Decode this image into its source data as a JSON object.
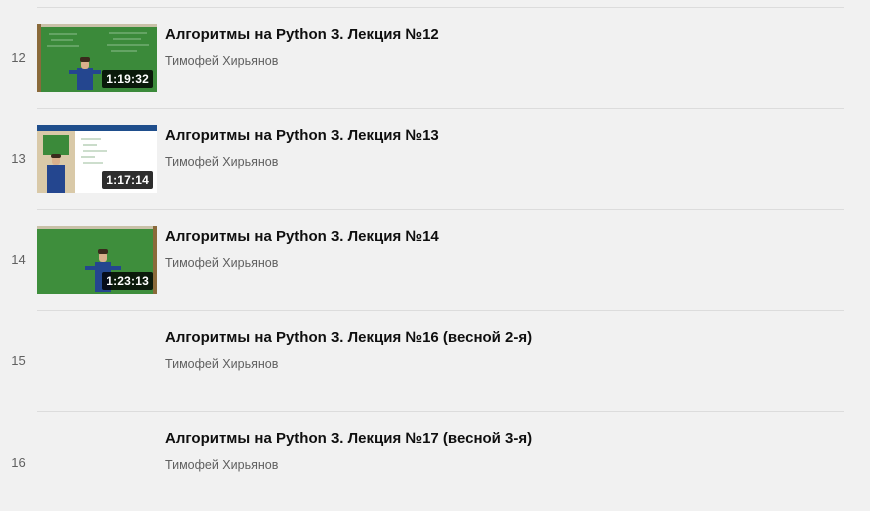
{
  "playlist": {
    "items": [
      {
        "index": "12",
        "title": "Алгоритмы на Python 3. Лекция №12",
        "channel": "Тимофей Хирьянов",
        "duration": "1:19:32",
        "thumb": "chalkboard-lecturer"
      },
      {
        "index": "13",
        "title": "Алгоритмы на Python 3. Лекция №13",
        "channel": "Тимофей Хирьянов",
        "duration": "1:17:14",
        "thumb": "slide-lecturer"
      },
      {
        "index": "14",
        "title": "Алгоритмы на Python 3. Лекция №14",
        "channel": "Тимофей Хирьянов",
        "duration": "1:23:13",
        "thumb": "chalkboard-lecturer"
      },
      {
        "index": "15",
        "title": "Алгоритмы на Python 3. Лекция №16 (весной 2-я)",
        "channel": "Тимофей Хирьянов",
        "duration": "",
        "thumb": "none"
      },
      {
        "index": "16",
        "title": "Алгоритмы на Python 3. Лекция №17 (весной 3-я)",
        "channel": "Тимофей Хирьянов",
        "duration": "",
        "thumb": "none"
      }
    ]
  },
  "colors": {
    "background": "#f1f1f1",
    "separator": "#dcdcdc",
    "title": "#0f0f0f",
    "secondary_text": "#606060",
    "chalkboard": "#3b8a3a",
    "lecturer_jacket": "#24468f"
  }
}
